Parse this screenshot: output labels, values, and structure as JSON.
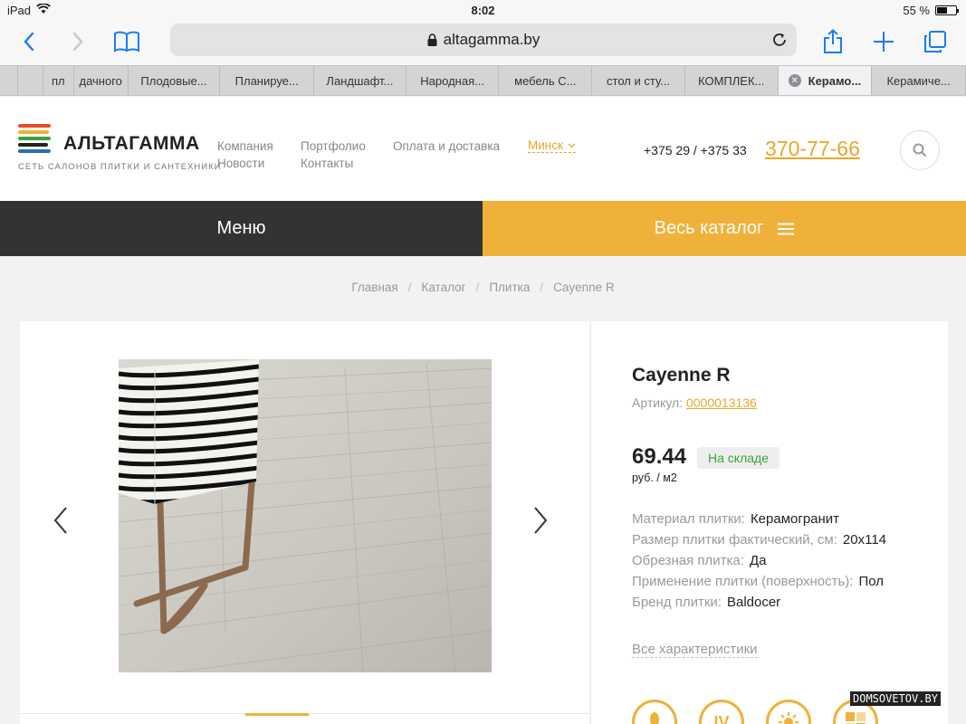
{
  "status_bar": {
    "device": "iPad",
    "time": "8:02",
    "battery": "55 %",
    "battery_level": 0.55
  },
  "browser": {
    "url": "altagamma.by",
    "tabs": [
      {
        "label": "пл"
      },
      {
        "label": "дачного"
      },
      {
        "label": "Плодовые..."
      },
      {
        "label": "Планируе..."
      },
      {
        "label": "Ландшафт..."
      },
      {
        "label": "Народная..."
      },
      {
        "label": "мебель С..."
      },
      {
        "label": "стол и сту..."
      },
      {
        "label": "КОМПЛЕК..."
      },
      {
        "label": "Керамо...",
        "active": true
      },
      {
        "label": "Керамиче..."
      }
    ]
  },
  "header": {
    "brand": "АЛЬТАГАММА",
    "tagline": "СЕТЬ САЛОНОВ ПЛИТКИ И САНТЕХНИКИ",
    "nav": {
      "company": "Компания",
      "news": "Новости",
      "portfolio": "Портфолио",
      "contacts": "Контакты",
      "payment": "Оплата и доставка"
    },
    "city": "Минск",
    "phone_prefix": "+375 29 / +375 33",
    "phone_main": "370-77-66",
    "logo_colors": [
      "#e74c2b",
      "#efb139",
      "#3aa43a",
      "#222222",
      "#2a6fb5"
    ]
  },
  "menubar": {
    "menu_label": "Меню",
    "catalog_label": "Весь каталог"
  },
  "breadcrumb": {
    "home": "Главная",
    "catalog": "Каталог",
    "tile": "Плитка",
    "current": "Cayenne R"
  },
  "product": {
    "title": "Cayenne R",
    "sku_label": "Артикул:",
    "sku": "0000013136",
    "price": "69.44",
    "stock": "На складе",
    "unit": "руб. / м2",
    "specs": [
      {
        "k": "Материал плитки:",
        "v": "Керамогранит"
      },
      {
        "k": "Размер плитки фактический, см:",
        "v": "20x114"
      },
      {
        "k": "Обрезная плитка:",
        "v": "Да"
      },
      {
        "k": "Применение плитки (поверхность):",
        "v": "Пол"
      },
      {
        "k": "Бренд плитки:",
        "v": "Baldocer"
      }
    ],
    "all_chars": "Все характеристики",
    "feature_icons": [
      {
        "icon": "foot-icon",
        "text": ""
      },
      {
        "icon": "wear-class-icon",
        "text": "IV"
      },
      {
        "icon": "frost-icon",
        "text": ""
      },
      {
        "icon": "pattern-icon",
        "text": ""
      }
    ]
  },
  "colors": {
    "accent": "#efb139",
    "dark": "#333333",
    "green": "#3aa43a"
  },
  "watermark": "DOMSOVETOV.BY"
}
